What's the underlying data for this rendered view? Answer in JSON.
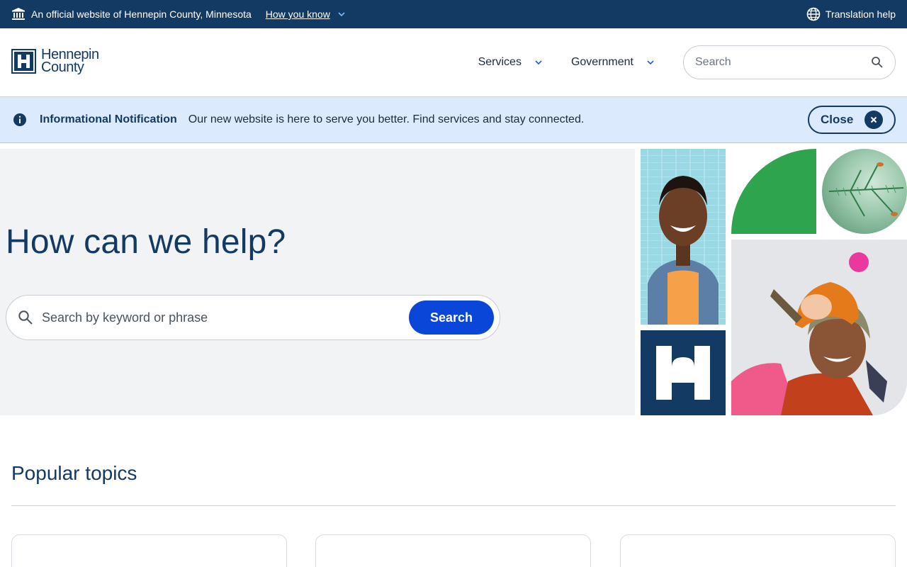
{
  "gov_bar": {
    "official_text": "An official website of Hennepin County, Minnesota",
    "how_you_know": "How you know",
    "translation_help": "Translation help",
    "icons": {
      "building": "building-icon",
      "chevron": "chevron-down-icon",
      "globe": "globe-icon"
    }
  },
  "header": {
    "logo_line1": "Hennepin",
    "logo_line2": "County",
    "nav": [
      {
        "label": "Services"
      },
      {
        "label": "Government"
      }
    ],
    "search_placeholder": "Search"
  },
  "notification": {
    "title": "Informational Notification",
    "message": "Our new website is here to serve you better. Find services and stay connected.",
    "close_label": "Close"
  },
  "hero": {
    "heading": "How can we help?",
    "search_placeholder": "Search by keyword or phrase",
    "search_button": "Search"
  },
  "popular": {
    "title": "Popular topics"
  },
  "colors": {
    "brand_navy": "#133a63",
    "accent_blue": "#0a46d8",
    "notice_bg": "#dbeafc",
    "hero_bg": "#f2f3f5",
    "green": "#2ea44f"
  }
}
